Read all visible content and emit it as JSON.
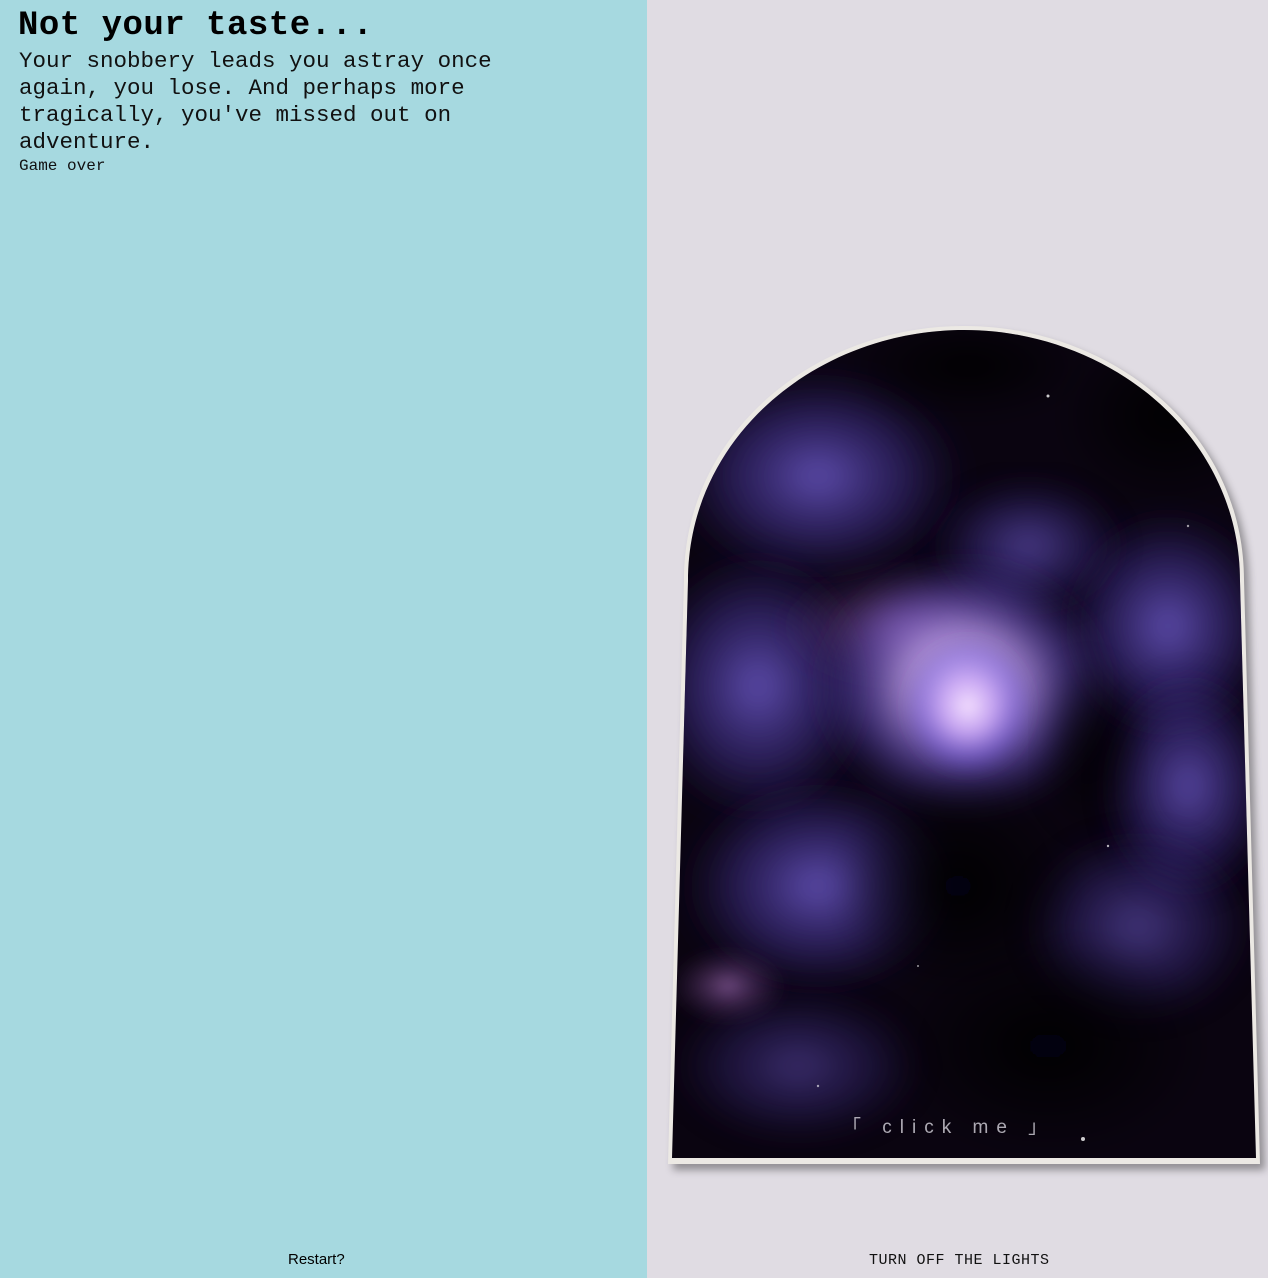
{
  "scene": {
    "title": "Not your taste...",
    "story": "Your snobbery leads you astray once again, you lose. And perhaps more tragically, you've missed out on adventure.",
    "status": "Game over"
  },
  "controls": {
    "restart_label": "Restart?",
    "lights_label": "TURN OFF THE LIGHTS"
  },
  "portal": {
    "click_label": "「 click me 」"
  },
  "colors": {
    "left_panel": "#a6d9e0",
    "right_panel": "#e0dce3",
    "portal_frame": "#ece9e4",
    "nebula_dark": "#08030c",
    "nebula_violet": "#6a4fd8",
    "nebula_glow": "#f3d9ff"
  }
}
